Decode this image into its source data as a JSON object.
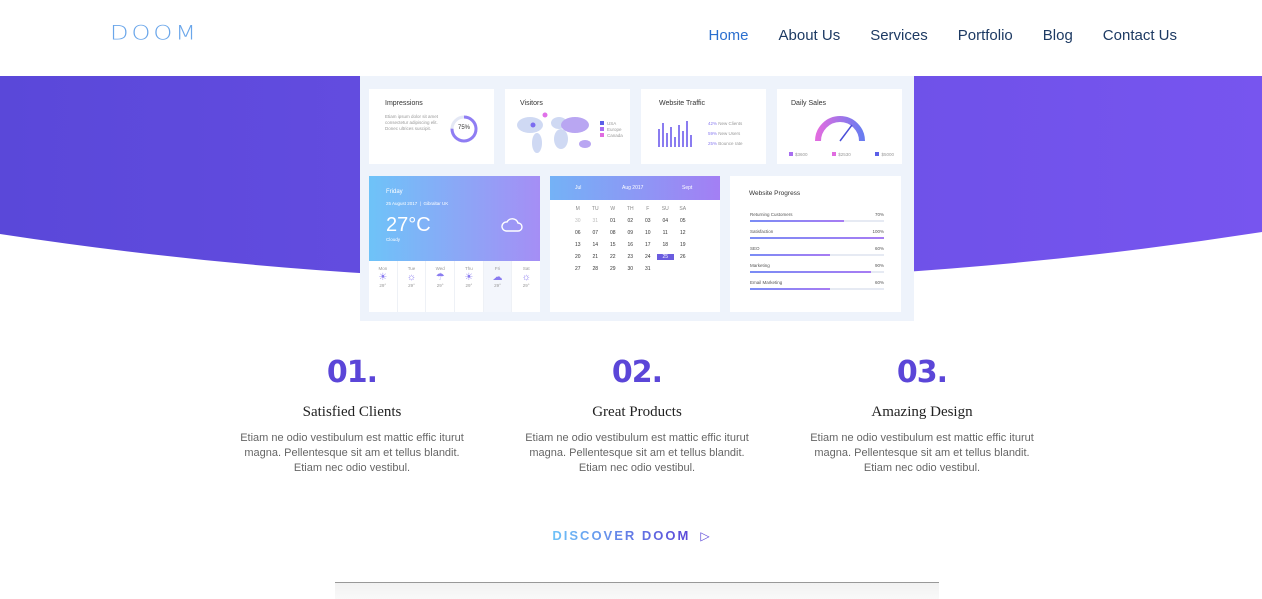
{
  "logo": {
    "text": "DOOM"
  },
  "nav": {
    "items": [
      {
        "label": "Home",
        "active": true
      },
      {
        "label": "About Us"
      },
      {
        "label": "Services"
      },
      {
        "label": "Portfolio"
      },
      {
        "label": "Blog"
      },
      {
        "label": "Contact Us"
      }
    ]
  },
  "colors": {
    "accent": "#5b46d8",
    "hero_start": "#5a48d9",
    "hero_end": "#7755ef",
    "nav_text": "#1d3a63",
    "nav_active": "#2b6fcf"
  },
  "dashboard": {
    "impressions": {
      "title": "Impressions",
      "text": "Etiam ipsum dolor sit amet consectetur adipiscing elit. Donec ultrices suscipit.",
      "percent": "75%"
    },
    "visitors": {
      "title": "Visitors",
      "legend": [
        "USA",
        "Europe",
        "Canada"
      ]
    },
    "traffic": {
      "title": "Website Traffic",
      "rows": [
        {
          "pct": "42%",
          "label": "New Clients"
        },
        {
          "pct": "59%",
          "label": "New Users"
        },
        {
          "pct": "25%",
          "label": "Bounce rate"
        }
      ]
    },
    "sales": {
      "title": "Daily Sales",
      "legend": [
        "$3600",
        "$2530",
        "$5000"
      ]
    },
    "weather": {
      "day": "Friday",
      "date": "25 August 2017",
      "location": "Gibraltar UK",
      "temp": "27°C",
      "condition": "Cloudy",
      "days": [
        {
          "name": "Mon",
          "temp": "29°"
        },
        {
          "name": "Tue",
          "temp": "29°"
        },
        {
          "name": "Wed",
          "temp": "29°"
        },
        {
          "name": "Thu",
          "temp": "29°"
        },
        {
          "name": "Fri",
          "temp": "29°"
        },
        {
          "name": "Sat",
          "temp": "29°"
        }
      ]
    },
    "calendar": {
      "prev": "Jul",
      "month": "Aug 2017",
      "next": "Sept",
      "weekdays": [
        "M",
        "TU",
        "W",
        "TH",
        "F",
        "SU",
        "SA"
      ],
      "rows": [
        [
          "30",
          "31",
          "01",
          "02",
          "03",
          "04",
          "05"
        ],
        [
          "06",
          "07",
          "08",
          "09",
          "10",
          "11",
          "12"
        ],
        [
          "13",
          "14",
          "15",
          "16",
          "17",
          "18",
          "19"
        ],
        [
          "20",
          "21",
          "22",
          "23",
          "24",
          "25",
          "26"
        ],
        [
          "27",
          "28",
          "29",
          "30",
          "31",
          "",
          ""
        ]
      ],
      "selected": "25"
    },
    "progress": {
      "title": "Website Progress",
      "rows": [
        {
          "label": "Returning Customers",
          "value": "70%",
          "fraction": 0.7
        },
        {
          "label": "Satisfaction",
          "value": "100%",
          "fraction": 1.0
        },
        {
          "label": "SEO",
          "value": "60%",
          "fraction": 0.6
        },
        {
          "label": "Marketing",
          "value": "90%",
          "fraction": 0.9
        },
        {
          "label": "Email Marketing",
          "value": "60%",
          "fraction": 0.6
        }
      ]
    }
  },
  "features": [
    {
      "num": "01.",
      "title": "Satisfied Clients",
      "desc": "Etiam ne odio vestibulum est mattic effic iturut magna. Pellentesque sit am et tellus blandit. Etiam nec odio vestibul."
    },
    {
      "num": "02.",
      "title": "Great Products",
      "desc": "Etiam ne odio vestibulum est mattic effic iturut magna. Pellentesque sit am et tellus blandit. Etiam nec odio vestibul."
    },
    {
      "num": "03.",
      "title": "Amazing Design",
      "desc": "Etiam ne odio vestibulum est mattic effic iturut magna. Pellentesque sit am et tellus blandit. Etiam nec odio vestibul."
    }
  ],
  "cta": {
    "label": "DISCOVER DOOM"
  }
}
